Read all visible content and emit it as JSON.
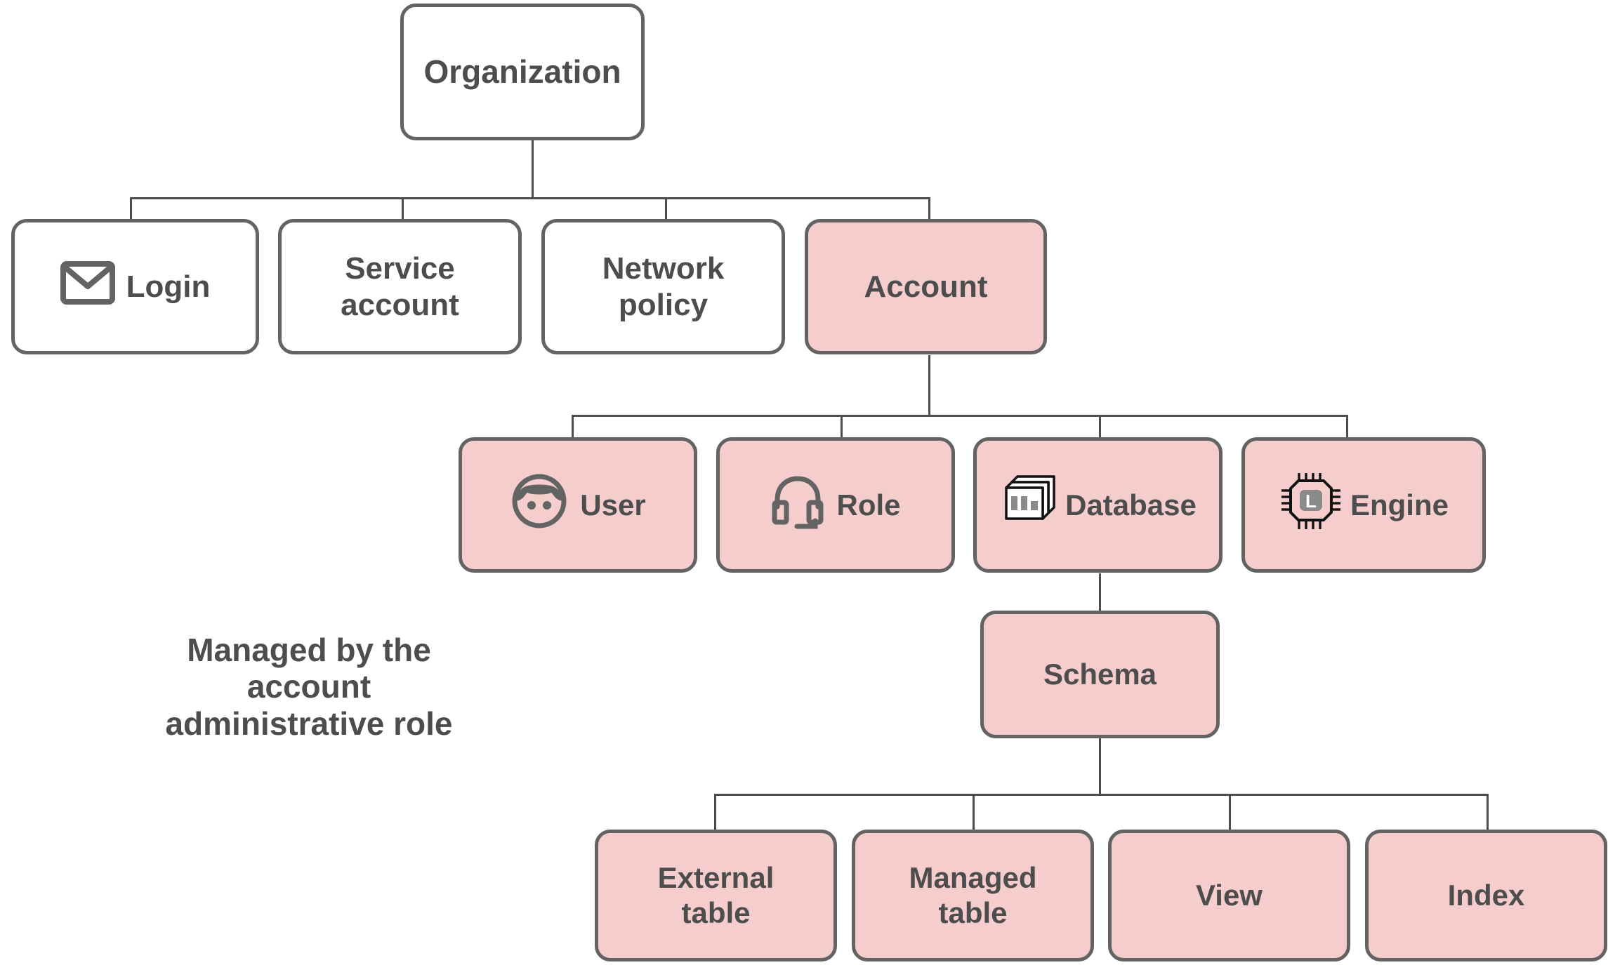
{
  "diagram": {
    "type": "hierarchy-tree",
    "title_node": "Organization",
    "colors": {
      "filled_fill": "#f5cdcd",
      "plain_fill": "#ffffff",
      "border": "#636363",
      "text": "#4d4d4d",
      "connector": "#4d4d4d",
      "background": "#ffffff"
    },
    "caption": "Managed by the\naccount\nadministrative role",
    "nodes": {
      "organization": {
        "label": "Organization",
        "filled": false,
        "icon": null
      },
      "login": {
        "label": "Login",
        "filled": false,
        "icon": "envelope-icon"
      },
      "service_account": {
        "label": "Service\naccount",
        "filled": false,
        "icon": null
      },
      "network_policy": {
        "label": "Network\npolicy",
        "filled": false,
        "icon": null
      },
      "account": {
        "label": "Account",
        "filled": true,
        "icon": null
      },
      "user": {
        "label": "User",
        "filled": true,
        "icon": "user-face-icon"
      },
      "role": {
        "label": "Role",
        "filled": true,
        "icon": "headset-icon"
      },
      "database": {
        "label": "Database",
        "filled": true,
        "icon": "database-stack-icon"
      },
      "engine": {
        "label": "Engine",
        "filled": true,
        "icon": "cpu-chip-icon"
      },
      "schema": {
        "label": "Schema",
        "filled": true,
        "icon": null
      },
      "external_table": {
        "label": "External\ntable",
        "filled": true,
        "icon": null
      },
      "managed_table": {
        "label": "Managed\ntable",
        "filled": true,
        "icon": null
      },
      "view": {
        "label": "View",
        "filled": true,
        "icon": null
      },
      "index": {
        "label": "Index",
        "filled": true,
        "icon": null
      }
    },
    "edges": [
      {
        "from": "organization",
        "to": "login"
      },
      {
        "from": "organization",
        "to": "service_account"
      },
      {
        "from": "organization",
        "to": "network_policy"
      },
      {
        "from": "organization",
        "to": "account"
      },
      {
        "from": "account",
        "to": "user"
      },
      {
        "from": "account",
        "to": "role"
      },
      {
        "from": "account",
        "to": "database"
      },
      {
        "from": "account",
        "to": "engine"
      },
      {
        "from": "database",
        "to": "schema"
      },
      {
        "from": "schema",
        "to": "external_table"
      },
      {
        "from": "schema",
        "to": "managed_table"
      },
      {
        "from": "schema",
        "to": "view"
      },
      {
        "from": "schema",
        "to": "index"
      }
    ],
    "engine_icon_letter": "L"
  }
}
